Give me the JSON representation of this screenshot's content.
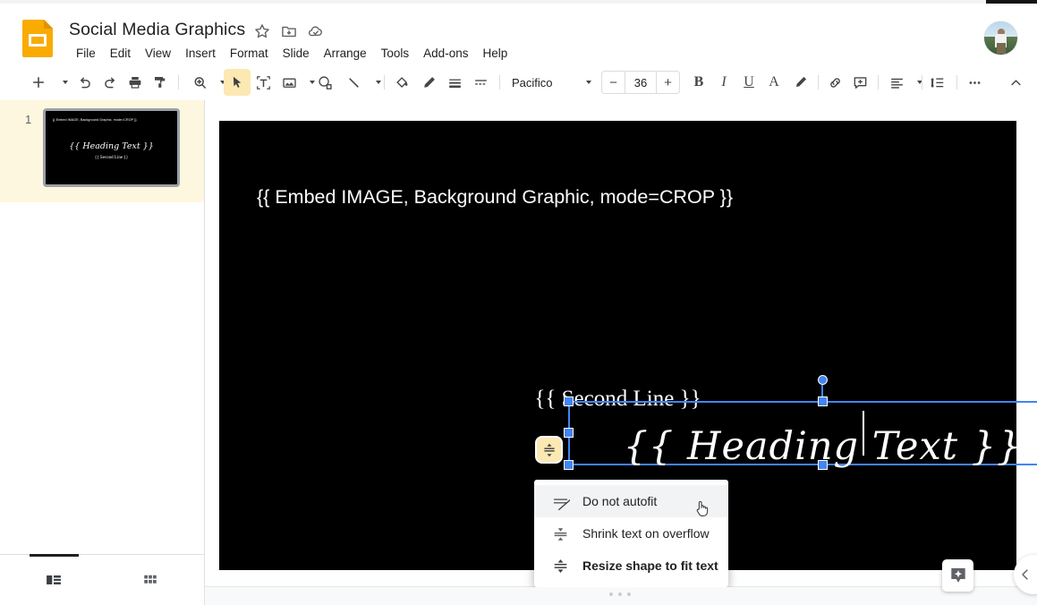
{
  "app": {
    "name": "Google Slides",
    "logo_icon": "slides-logo-icon"
  },
  "header": {
    "doc_title": "Social Media Graphics",
    "star_icon": "star-icon",
    "move_icon": "move-to-folder-icon",
    "cloud_icon": "cloud-saved-icon",
    "avatar_label": "account-avatar",
    "menus": [
      "File",
      "Edit",
      "View",
      "Insert",
      "Format",
      "Slide",
      "Arrange",
      "Tools",
      "Add-ons",
      "Help"
    ]
  },
  "toolbar": {
    "new_slide_label": "+",
    "items": [
      "new-slide-icon",
      "undo-icon",
      "redo-icon",
      "print-icon",
      "paint-format-icon",
      "zoom-icon",
      "select-icon",
      "text-box-icon",
      "insert-image-icon",
      "shape-icon",
      "line-icon",
      "fill-color-icon",
      "border-color-icon",
      "border-weight-icon",
      "border-dash-icon"
    ],
    "font_name": "Pacifico",
    "font_size": "36",
    "decrease_label": "−",
    "increase_label": "+",
    "bold_label": "B",
    "italic_label": "I",
    "underline_label": "U",
    "text_color_label": "A",
    "highlight_icon": "highlight-color-icon",
    "link_icon": "insert-link-icon",
    "comment_icon": "add-comment-icon",
    "align_icon": "align-icon",
    "line_spacing_icon": "line-spacing-icon",
    "more_label": "…",
    "collapse_icon": "collapse-toolbar-icon"
  },
  "filmstrip": {
    "slide_number": "1",
    "thumb_line1": "{{ Embed IMAGE, Background Graphic, mode=CROP }}",
    "thumb_heading": "{{ Heading Text }}",
    "thumb_line2": "{{ Second Line }}"
  },
  "slide": {
    "line1": "{{ Embed IMAGE, Background Graphic, mode=CROP }}",
    "heading_before_caret": "{{ Heading ",
    "heading_after_caret": "Text }}",
    "heading_full": "{{ Heading Text }}",
    "second_line": "{{ Second Line }}",
    "background_color": "#000000",
    "selection_color": "#4285f4",
    "autofit_badge_icon": "autofit-badge-icon",
    "autofit_badge_color": "#fce8b2"
  },
  "autofit_menu": {
    "items": [
      {
        "label": "Do not autofit",
        "icon": "do-not-autofit-icon",
        "hovered": true,
        "selected": false
      },
      {
        "label": "Shrink text on overflow",
        "icon": "shrink-text-on-overflow-icon",
        "hovered": false,
        "selected": false
      },
      {
        "label": "Resize shape to fit text",
        "icon": "resize-shape-to-fit-text-icon",
        "hovered": false,
        "selected": true
      }
    ],
    "cursor_icon": "pointing-hand-cursor"
  },
  "bottom": {
    "filmstrip_view_icon": "filmstrip-view-icon",
    "grid_view_icon": "grid-view-icon",
    "drag_handle_icon": "drag-handle-icon",
    "explore_icon": "explore-icon",
    "expand_panel_icon": "chevron-left-icon"
  },
  "colors": {
    "accent": "#4285f4",
    "brand_yellow": "#f9ab00",
    "highlight": "#fce8b2",
    "selected_row": "#fef7e0"
  }
}
